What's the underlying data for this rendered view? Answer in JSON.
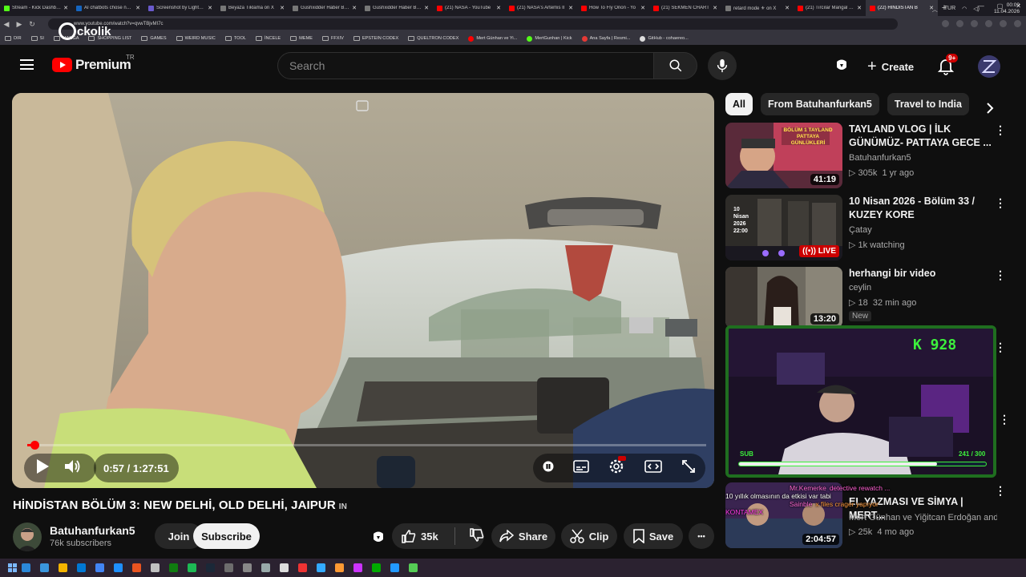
{
  "browser": {
    "tabs": [
      {
        "title": "Stream - Kick Dashboard",
        "color": "#53fc18"
      },
      {
        "title": "AI chatbots chose nuclear",
        "color": "#1565c0"
      },
      {
        "title": "Screenshot by Lightshot",
        "color": "#6a5acd"
      },
      {
        "title": "Beyaza Tıklama on X",
        "color": "#777777"
      },
      {
        "title": "Gushxidder Haber Bülteni",
        "color": "#777777"
      },
      {
        "title": "Gushxidder Haber Bülteni",
        "color": "#777777"
      },
      {
        "title": "(21) NASA - YouTube",
        "color": "#ff0000"
      },
      {
        "title": "(21) NASA's Artemis II",
        "color": "#ff0000"
      },
      {
        "title": "How To Fly Orion - Yo",
        "color": "#ff0000"
      },
      {
        "title": "(21) SEKMEN CHART",
        "color": "#ff0000"
      },
      {
        "title": "retard mode ⚜ on X",
        "color": "#777777"
      },
      {
        "title": "(21) Tırcılar Mangal Bu",
        "color": "#ff0000"
      },
      {
        "title": "(22) HİNDİSTAN B",
        "color": "#ff0000",
        "active": true
      }
    ],
    "new_tab": "+",
    "window_controls": [
      "—",
      "▢",
      "✕"
    ],
    "url": "www.youtube.com/watch?v=qvwTBjvMI7c",
    "overlay_logo": "ckolik",
    "bookmarks": [
      {
        "label": "DIR",
        "type": "folder"
      },
      {
        "label": "SI",
        "type": "folder"
      },
      {
        "label": "MANGA",
        "type": "folder"
      },
      {
        "label": "SHOPPING LIST",
        "type": "folder"
      },
      {
        "label": "GAMES",
        "type": "folder"
      },
      {
        "label": "WEIRD MUSIC",
        "type": "folder"
      },
      {
        "label": "TOOL",
        "type": "folder"
      },
      {
        "label": "İNCELE",
        "type": "folder"
      },
      {
        "label": "MEME",
        "type": "folder"
      },
      {
        "label": "FFXIV",
        "type": "folder"
      },
      {
        "label": "EPSTEIN CODEX",
        "type": "folder"
      },
      {
        "label": "QUELTRON CODEX",
        "type": "folder"
      },
      {
        "label": "Mert Günhan ve Yi...",
        "type": "site",
        "color": "#ff0000"
      },
      {
        "label": "MertGunhan | Kick",
        "type": "site",
        "color": "#53fc18"
      },
      {
        "label": "Ana Sayfa | Resmi...",
        "type": "site",
        "color": "#e53935"
      },
      {
        "label": "GitHub - cohaereo...",
        "type": "site",
        "color": "#dddddd"
      }
    ]
  },
  "header": {
    "logo_text": "Premium",
    "country": "TR",
    "search_placeholder": "Search",
    "create_label": "Create",
    "notification_count": "9+"
  },
  "player": {
    "current_time": "0:57",
    "separator": "/",
    "duration": "1:27:51",
    "progress": 0.011
  },
  "video": {
    "title": "HİNDİSTAN BÖLÜM 3: NEW DELHİ, OLD DELHİ, JAIPUR",
    "country_tag": "IN",
    "channel": "Batuhanfurkan5",
    "subscribers": "76k subscribers",
    "join_label": "Join",
    "subscribe_label": "Subscribe",
    "likes": "35k",
    "share_label": "Share",
    "clip_label": "Clip",
    "save_label": "Save",
    "more_label": "•••"
  },
  "chips": [
    "All",
    "From Batuhanfurkan5",
    "Travel to India"
  ],
  "recommendations": [
    {
      "title": "TAYLAND VLOG | İLK GÜNÜMÜZ- PATTAYA GECE ...",
      "channel": "Batuhanfurkan5",
      "views": "305k",
      "age": "1 yr ago",
      "duration": "41:19",
      "thumb_text": "BÖLÜM 1 TAYLAND PATTAYA GÜNLÜKLERİ"
    },
    {
      "title": "10 Nisan 2026 - Bölüm 33 / KUZEY KORE",
      "channel": "Çatay",
      "views": "1k watching",
      "live": "LIVE",
      "thumb_text": "10 Nisan 2026 22:00"
    },
    {
      "title": "herhangi  bir video",
      "channel": "ceylin",
      "views": "18",
      "age": "32 min ago",
      "duration": "13:20",
      "new": "New"
    },
    {
      "title": "EL YAZMASI VE SİMYA | MERT...",
      "channel": "Mert Günhan ve Yiğitcan Erdoğan and c...",
      "views": "25k",
      "age": "4 mo ago",
      "duration": "2:04:57"
    }
  ],
  "stream_overlay": {
    "kick_count": "K 928",
    "sub_label": "SUB",
    "sub_progress": "241 / 300",
    "sub_fraction": 0.803,
    "chat": [
      {
        "user": "Mr.Kemerke",
        "text": "detective rewatch ...",
        "color": "#ff5fd2"
      },
      {
        "user": "",
        "text": "10 yıllık olmasının da etkisi var tabi",
        "color": "#ffffff"
      },
      {
        "user": "Sainble",
        "text": "x files crager yapıyor",
        "color": "#ff9a3c"
      },
      {
        "user": "",
        "text": "KONTAMEX",
        "color": "#ff3ce8"
      }
    ]
  },
  "taskbar": {
    "language": "TUR",
    "time": "00:09",
    "date": "11.04.2026"
  }
}
